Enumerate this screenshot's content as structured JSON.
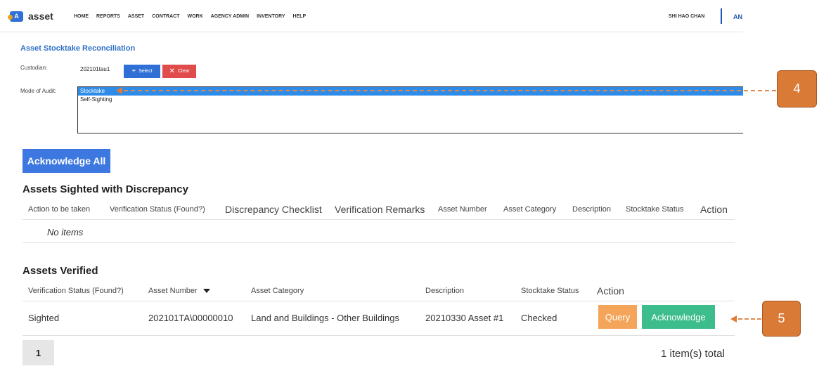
{
  "app": {
    "logo_letter": "A",
    "name": "asset"
  },
  "nav": {
    "items": [
      "HOME",
      "REPORTS",
      "ASSET",
      "CONTRACT",
      "WORK",
      "AGENCY ADMIN",
      "INVENTORY",
      "HELP"
    ]
  },
  "user": {
    "name": "SHI HAO CHAN",
    "tab": "AN"
  },
  "form": {
    "title": "Asset Stocktake Reconciliation",
    "custodian_label": "Custodian:",
    "custodian_value": "202101tau1",
    "select_label": "Select",
    "clear_label": "Clear",
    "mode_label": "Mode of Audit:",
    "mode_options": [
      "Stocktake",
      "Self-Sighting"
    ],
    "mode_selected": "Stocktake"
  },
  "acknowledge_all_label": "Acknowledge All",
  "discrepancy": {
    "title": "Assets Sighted with Discrepancy",
    "headers": [
      "Action to be taken",
      "Verification Status (Found?)",
      "Discrepancy Checklist",
      "Verification Remarks",
      "Asset Number",
      "Asset Category",
      "Description",
      "Stocktake Status",
      "Action"
    ],
    "empty_text": "No items"
  },
  "verified": {
    "title": "Assets Verified",
    "headers": [
      "Verification Status (Found?)",
      "Asset Number",
      "Asset Category",
      "Description",
      "Stocktake Status",
      "Action"
    ],
    "sort_column": "Asset Number",
    "rows": [
      {
        "status": "Sighted",
        "asset_number": "202101TA\\00000010",
        "category": "Land and Buildings - Other Buildings",
        "description": "20210330 Asset #1",
        "stocktake_status": "Checked",
        "query_label": "Query",
        "acknowledge_label": "Acknowledge"
      }
    ]
  },
  "pagination": {
    "current_page": "1",
    "total_text": "1 item(s) total"
  },
  "callouts": {
    "first": "4",
    "second": "5"
  },
  "colors": {
    "primary": "#2f6fd6",
    "danger": "#e04b4b",
    "query": "#f5a55a",
    "acknowledge": "#3dbd8c",
    "callout": "#d97b37",
    "selected_option": "#2e8be8"
  }
}
